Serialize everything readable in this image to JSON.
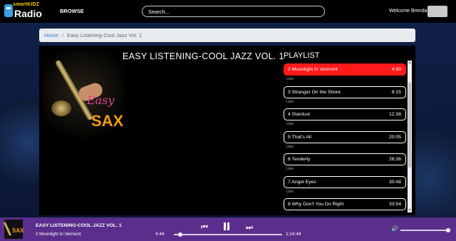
{
  "app": {
    "logo_top": "smart",
    "logo_kidz": "KIDZ",
    "logo_bottom": "Radio",
    "browse_label": "BROWSE",
    "search_placeholder": "Search...",
    "welcome_text": "Welcome Brenda"
  },
  "breadcrumb": {
    "home": "Home",
    "current": "Easy Listening-Cool Jazz Vol. 1"
  },
  "album": {
    "title": "EASY LISTENING-COOL JAZZ VOL. 1",
    "cover_word1": "Easy",
    "cover_word2": "SAX"
  },
  "playlist": {
    "heading": "PLAYLIST",
    "like_label": "Like",
    "tracks": [
      {
        "title": "2 Moonlight In Vermont",
        "duration": "4:30",
        "active": true
      },
      {
        "title": "3 Stranger On the Shore",
        "duration": "8:15",
        "active": false
      },
      {
        "title": "4 Stardust",
        "duration": "12:38",
        "active": false
      },
      {
        "title": "5 That's All",
        "duration": "20:05",
        "active": false
      },
      {
        "title": "6 Tenderly",
        "duration": "26:36",
        "active": false
      },
      {
        "title": "7 Angel Eyes",
        "duration": "30:48",
        "active": false
      },
      {
        "title": "8 Why Don't You Do Right",
        "duration": "33:54",
        "active": false
      }
    ]
  },
  "player": {
    "album_title": "EASY LISTENING-COOL JAZZ VOL. 1",
    "track_title": "2 Moonlight In Vermont",
    "thumb_text": "SAX",
    "time_current": "4:44",
    "time_total": "1:24:44",
    "progress_fraction": 0.056,
    "volume_fraction": 0.95
  },
  "colors": {
    "active_track": "#ff1a1a",
    "player_bar": "#5b2d8c",
    "cover_easy": "#e0449a",
    "cover_sax": "#f29a1a"
  }
}
